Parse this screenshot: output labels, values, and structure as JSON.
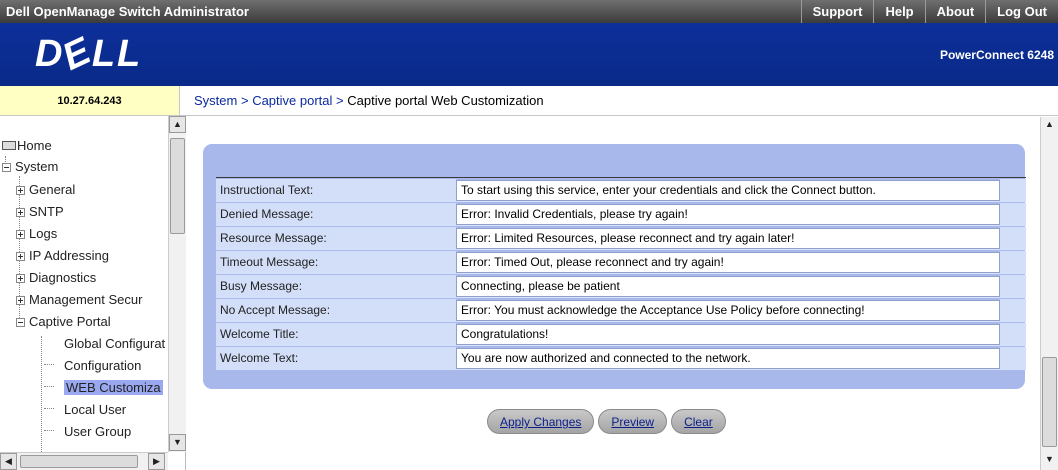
{
  "topbar": {
    "title": "Dell OpenManage Switch Administrator",
    "links": [
      "Support",
      "Help",
      "About",
      "Log Out"
    ]
  },
  "banner": {
    "logo": "DELL",
    "model": "PowerConnect 6248"
  },
  "device": {
    "ip": "10.27.64.243"
  },
  "breadcrumb": {
    "items": [
      "System",
      "Captive portal",
      "Captive portal Web Customization"
    ],
    "separator": ">"
  },
  "tree": {
    "home": "Home",
    "system": "System",
    "general": "General",
    "sntp": "SNTP",
    "logs": "Logs",
    "ip_addressing": "IP Addressing",
    "diagnostics": "Diagnostics",
    "management_security": "Management Secur",
    "captive_portal": "Captive Portal",
    "global_configuration": "Global Configurat",
    "configuration": "Configuration",
    "web_customization": "WEB Customiza",
    "local_user": "Local User",
    "user_group": "User Group"
  },
  "form": {
    "rows": [
      {
        "label": "Instructional Text:",
        "value": "To start using this service, enter your credentials and click the Connect button."
      },
      {
        "label": "Denied Message:",
        "value": "Error: Invalid Credentials, please try again!"
      },
      {
        "label": "Resource Message:",
        "value": "Error: Limited Resources, please reconnect and try again later!"
      },
      {
        "label": "Timeout Message:",
        "value": "Error: Timed Out, please reconnect and try again!"
      },
      {
        "label": "Busy Message:",
        "value": "Connecting, please be patient"
      },
      {
        "label": "No Accept Message:",
        "value": "Error: You must acknowledge the Acceptance Use Policy before connecting!"
      },
      {
        "label": "Welcome Title:",
        "value": "Congratulations!"
      },
      {
        "label": "Welcome Text:",
        "value": "You are now authorized and connected to the network."
      }
    ]
  },
  "actions": {
    "apply": "Apply Changes",
    "preview": "Preview",
    "clear": "Clear"
  },
  "colors": {
    "banner": "#0c2f9a",
    "panel": "#a8b8ea",
    "ip_box": "#ffffc4",
    "selected": "#9aa8f0"
  }
}
